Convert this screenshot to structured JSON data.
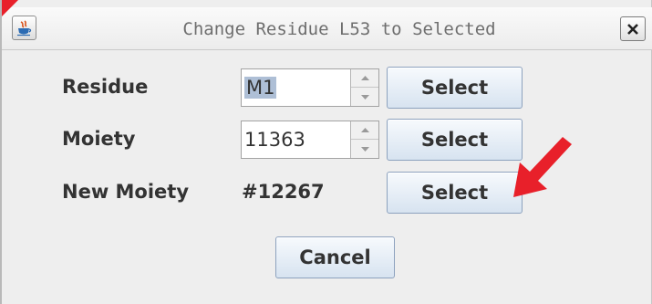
{
  "dialog": {
    "title": "Change Residue L53 to Selected"
  },
  "rows": [
    {
      "label": "Residue",
      "value": "M1",
      "value_selected": true,
      "button": "Select"
    },
    {
      "label": "Moiety",
      "value": "11363",
      "value_selected": false,
      "button": "Select"
    },
    {
      "label": "New Moiety",
      "value": "#12267",
      "button": "Select"
    }
  ],
  "footer": {
    "cancel_label": "Cancel"
  },
  "icons": {
    "app": "java-app-icon",
    "close": "close-icon",
    "spin_up": "spinner-up-icon",
    "spin_down": "spinner-down-icon",
    "pointer": "red-arrow-annotation"
  },
  "colors": {
    "annotation_arrow": "#e8202a",
    "button_top": "#f7fafd",
    "button_bottom": "#d7e3f0",
    "selection": "#aebfd6"
  }
}
